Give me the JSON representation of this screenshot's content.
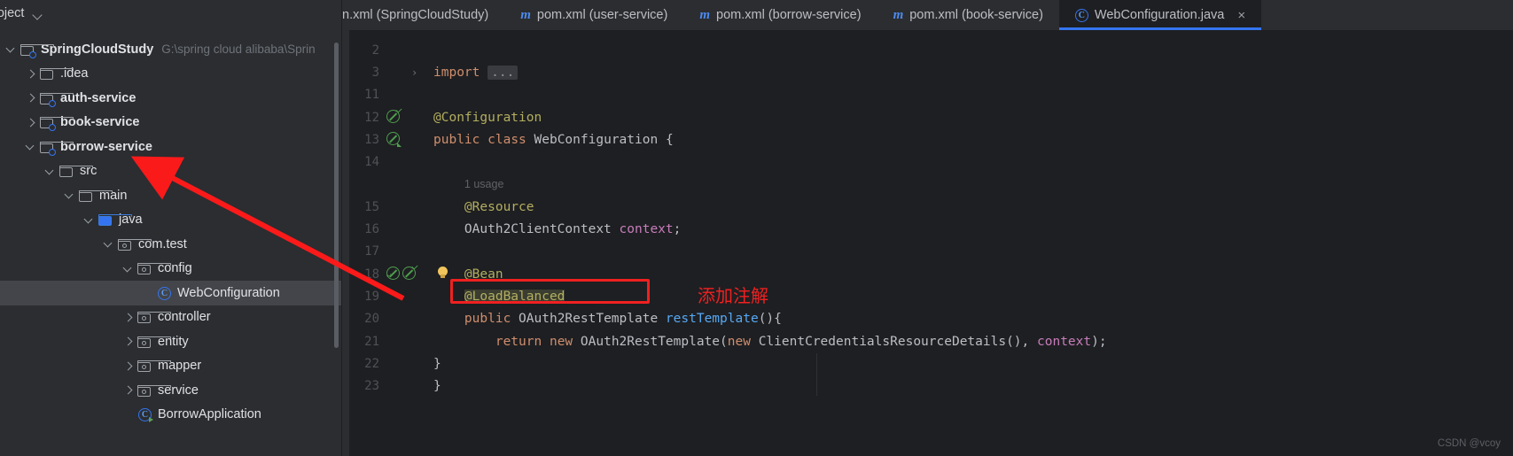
{
  "sidebar": {
    "header": {
      "title": "roject",
      "chevron_icon": "chevron-down-icon"
    },
    "tree": [
      {
        "label": "SpringCloudStudy",
        "path": "G:\\spring cloud alibaba\\Sprin",
        "indent": 0,
        "arrow": "down",
        "icon": "module-folder-icon",
        "bold": true,
        "selected": false
      },
      {
        "label": ".idea",
        "path": "",
        "indent": 1,
        "arrow": "right",
        "icon": "folder-icon",
        "bold": false,
        "selected": false
      },
      {
        "label": "auth-service",
        "path": "",
        "indent": 1,
        "arrow": "right",
        "icon": "module-folder-icon",
        "bold": true,
        "selected": false
      },
      {
        "label": "book-service",
        "path": "",
        "indent": 1,
        "arrow": "right",
        "icon": "module-folder-icon",
        "bold": true,
        "selected": false
      },
      {
        "label": "borrow-service",
        "path": "",
        "indent": 1,
        "arrow": "down",
        "icon": "module-folder-icon",
        "bold": true,
        "selected": false
      },
      {
        "label": "src",
        "path": "",
        "indent": 2,
        "arrow": "down",
        "icon": "folder-icon",
        "bold": false,
        "selected": false
      },
      {
        "label": "main",
        "path": "",
        "indent": 3,
        "arrow": "down",
        "icon": "folder-icon",
        "bold": false,
        "selected": false
      },
      {
        "label": "java",
        "path": "",
        "indent": 4,
        "arrow": "down",
        "icon": "source-folder-icon",
        "bold": false,
        "selected": false
      },
      {
        "label": "com.test",
        "path": "",
        "indent": 5,
        "arrow": "down",
        "icon": "package-icon",
        "bold": false,
        "selected": false
      },
      {
        "label": "config",
        "path": "",
        "indent": 6,
        "arrow": "down",
        "icon": "package-icon",
        "bold": false,
        "selected": false
      },
      {
        "label": "WebConfiguration",
        "path": "",
        "indent": 7,
        "arrow": "none",
        "icon": "java-class-icon",
        "bold": false,
        "selected": true
      },
      {
        "label": "controller",
        "path": "",
        "indent": 6,
        "arrow": "right",
        "icon": "package-icon",
        "bold": false,
        "selected": false
      },
      {
        "label": "entity",
        "path": "",
        "indent": 6,
        "arrow": "right",
        "icon": "package-icon",
        "bold": false,
        "selected": false
      },
      {
        "label": "mapper",
        "path": "",
        "indent": 6,
        "arrow": "right",
        "icon": "package-icon",
        "bold": false,
        "selected": false
      },
      {
        "label": "service",
        "path": "",
        "indent": 6,
        "arrow": "right",
        "icon": "package-icon",
        "bold": false,
        "selected": false
      },
      {
        "label": "BorrowApplication",
        "path": "",
        "indent": 6,
        "arrow": "none",
        "icon": "java-runnable-class-icon",
        "bold": false,
        "selected": false
      }
    ]
  },
  "tabs": [
    {
      "label": "n.xml (SpringCloudStudy)",
      "icon": "maven-icon",
      "active": false,
      "closable": false
    },
    {
      "label": "pom.xml (user-service)",
      "icon": "maven-icon",
      "active": false,
      "closable": false
    },
    {
      "label": "pom.xml (borrow-service)",
      "icon": "maven-icon",
      "active": false,
      "closable": false
    },
    {
      "label": "pom.xml (book-service)",
      "icon": "maven-icon",
      "active": false,
      "closable": false
    },
    {
      "label": "WebConfiguration.java",
      "icon": "java-class-icon",
      "active": true,
      "closable": true,
      "close_glyph": "×"
    }
  ],
  "editor": {
    "lines": [
      {
        "num": "2",
        "text": "",
        "marker": ""
      },
      {
        "num": "3",
        "text": "import",
        "marker": "",
        "fold": ">",
        "has_ellipsis": true
      },
      {
        "num": "11",
        "text": "",
        "marker": ""
      },
      {
        "num": "12",
        "text": "@Configuration",
        "marker": "bean-checked"
      },
      {
        "num": "13",
        "text": "public class WebConfiguration {",
        "marker": "bean"
      },
      {
        "num": "14",
        "text": "",
        "marker": ""
      },
      {
        "num": "",
        "text": "1 usage",
        "marker": "",
        "inlay": true
      },
      {
        "num": "15",
        "text": "@Resource",
        "marker": ""
      },
      {
        "num": "16",
        "text": "OAuth2ClientContext context;",
        "marker": ""
      },
      {
        "num": "17",
        "text": "",
        "marker": ""
      },
      {
        "num": "18",
        "text": "@Bean",
        "marker": "bean-double",
        "bulb": true
      },
      {
        "num": "19",
        "text": "@LoadBalanced",
        "marker": "",
        "selected": true
      },
      {
        "num": "20",
        "text": "public OAuth2RestTemplate restTemplate(){",
        "marker": ""
      },
      {
        "num": "21",
        "text": "return new OAuth2RestTemplate(new ClientCredentialsResourceDetails(), context);",
        "marker": ""
      },
      {
        "num": "22",
        "text": "}",
        "marker": ""
      },
      {
        "num": "23",
        "text": "}",
        "marker": ""
      }
    ],
    "import_keyword": "import",
    "import_ellipsis": "...",
    "inlay_usage": "1 usage"
  },
  "annotations": {
    "chinese_note": "添加注解",
    "note_color": "#f02020",
    "box_color": "#f02020",
    "arrow_color": "#fa1a1a"
  },
  "watermark": "CSDN @vcoy",
  "colors": {
    "sidebar_bg": "#2b2d30",
    "editor_bg": "#1e1f22",
    "selection_bg": "#43454a",
    "accent_blue": "#3574f0",
    "keyword": "#cf8e6d",
    "annotation": "#b3ae60",
    "method": "#56a8f5",
    "field": "#c77dbb",
    "plain": "#bcbec4",
    "line_number": "#4e5157",
    "bean_green": "#4f9e4f"
  }
}
